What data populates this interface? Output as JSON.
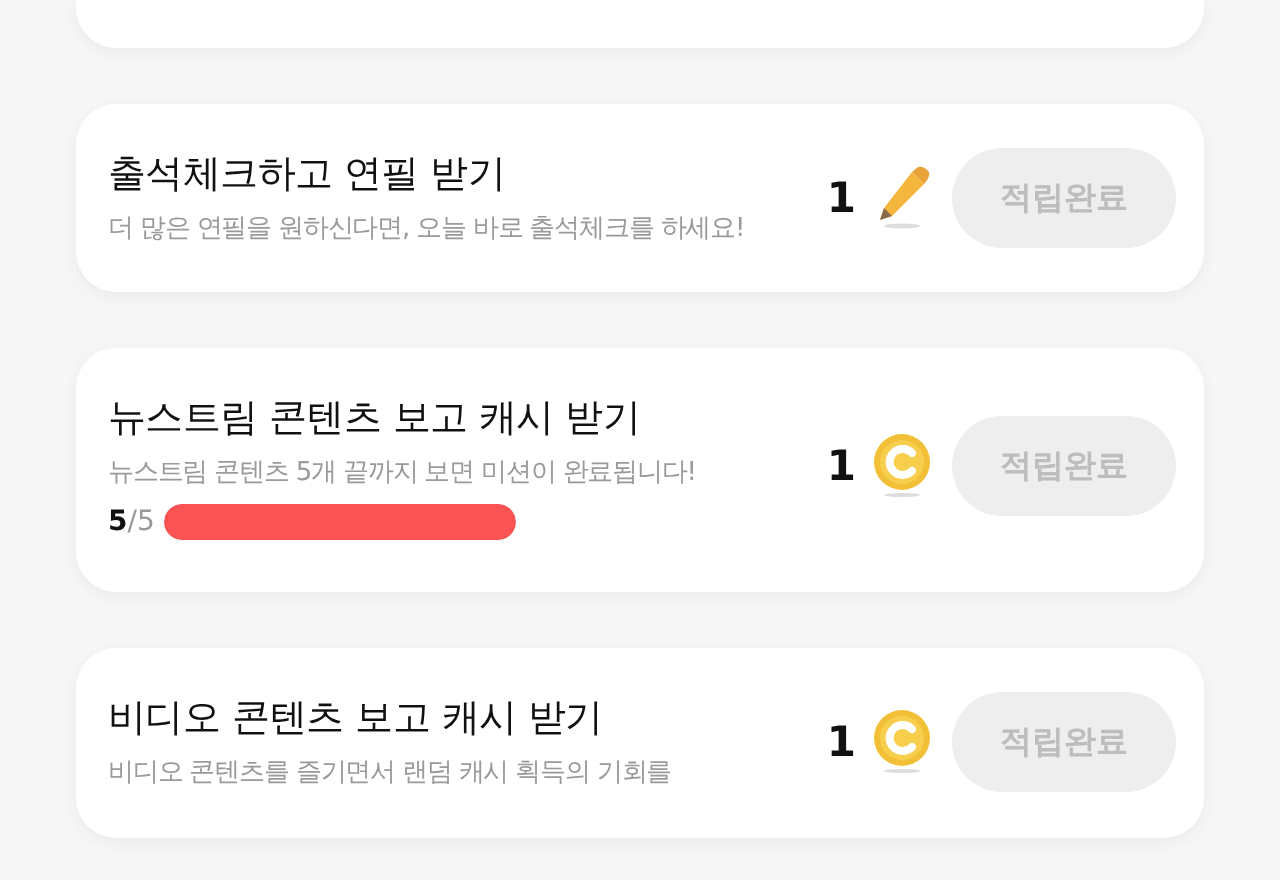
{
  "missions": [
    {
      "title": "출석체크하고 연필 받기",
      "description": "더 많은 연필을 원하신다면, 오늘 바로 출석체크를 하세요!",
      "reward": {
        "amount": "1",
        "kind": "pencil"
      },
      "button": {
        "label": "적립완료",
        "disabled": true
      }
    },
    {
      "title": "뉴스트림 콘텐츠 보고 캐시 받기",
      "description": "뉴스트림 콘텐츠 5개 끝까지 보면 미션이 완료됩니다!",
      "progress": {
        "text": "**5**/5",
        "level": 1
      },
      "reward": {
        "amount": "1",
        "kind": "coin"
      },
      "button": {
        "label": "적립완료",
        "disabled": true
      }
    },
    {
      "title": "비디오 콘텐츠 보고 캐시 받기",
      "description": "비디오 콘텐츠를 즐기면서 랜덤 캐시 획득의 기회를",
      "reward": {
        "amount": "1",
        "kind": "coin"
      },
      "button": {
        "label": "적립완료",
        "disabled": true
      }
    }
  ]
}
